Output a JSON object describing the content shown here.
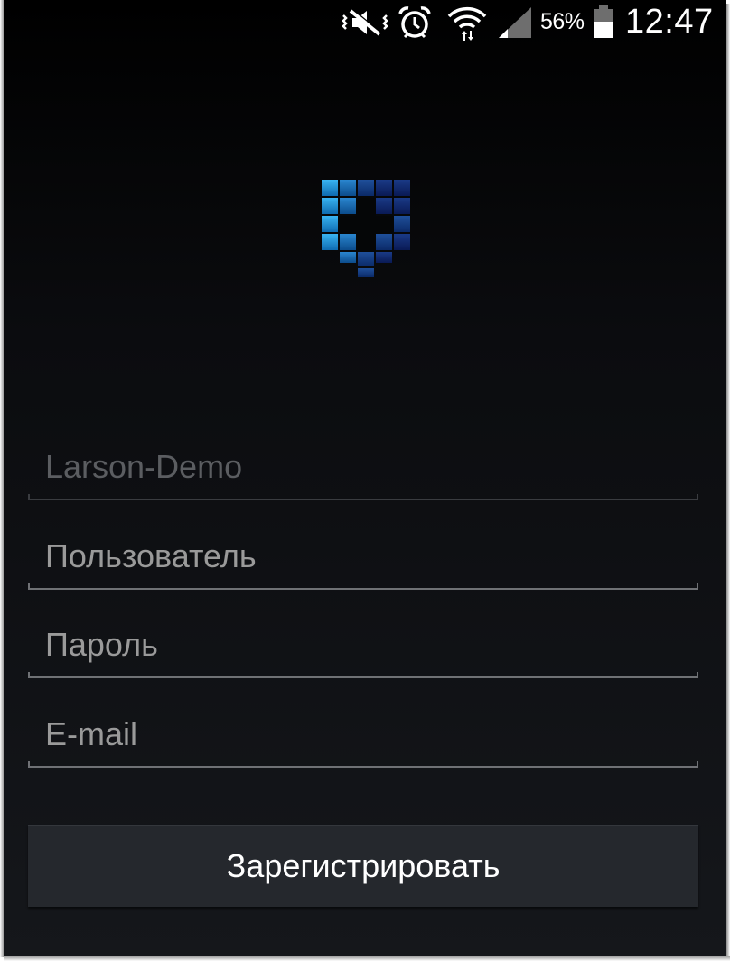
{
  "status_bar": {
    "icons": [
      "vibrate-mute-icon",
      "alarm-icon",
      "wifi-icon",
      "signal-icon",
      "battery-icon"
    ],
    "battery_percent": "56%",
    "time": "12:47"
  },
  "logo": {
    "icon": "shield-cross-logo",
    "colors": [
      "#1f8fd6",
      "#1565a8",
      "#0d3a7a",
      "#0a1f5a"
    ]
  },
  "form": {
    "server_field": {
      "value": "Larson-Demo",
      "enabled": false
    },
    "username_field": {
      "placeholder": "Пользователь"
    },
    "password_field": {
      "placeholder": "Пароль"
    },
    "email_field": {
      "placeholder": "E-mail"
    },
    "register_button_label": "Зарегистрировать"
  },
  "colors": {
    "background_top": "#000000",
    "background_bottom": "#15171b",
    "button_bg": "#25282d",
    "hint_text": "#9a9a9a",
    "disabled_text": "#5b5d61",
    "underline": "#6f7175"
  }
}
